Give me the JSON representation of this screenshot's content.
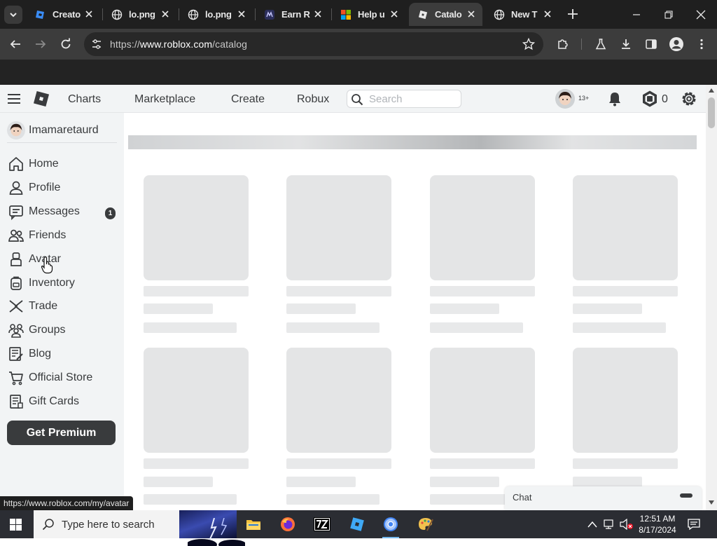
{
  "browser": {
    "tabs": [
      {
        "title": "Creato",
        "favicon": "creator-hub-icon"
      },
      {
        "title": "lo.png",
        "favicon": "globe-icon"
      },
      {
        "title": "lo.png",
        "favicon": "globe-icon"
      },
      {
        "title": "Earn R",
        "favicon": "earn-robux-icon"
      },
      {
        "title": "Help u",
        "favicon": "microsoft-icon"
      },
      {
        "title": "Catalo",
        "favicon": "roblox-icon",
        "active": true
      },
      {
        "title": "New T",
        "favicon": "globe-icon"
      }
    ],
    "url": {
      "scheme": "https://",
      "host": "www.roblox.com",
      "path": "/catalog"
    },
    "status_url": "https://www.roblox.com/my/avatar"
  },
  "roblox": {
    "nav": {
      "charts": "Charts",
      "marketplace": "Marketplace",
      "create": "Create",
      "robux": "Robux"
    },
    "search_placeholder": "Search",
    "age_label": "13+",
    "robux_balance": "0",
    "username": "Imamaretaurd",
    "sidebar": [
      {
        "label": "Home",
        "icon": "home-icon"
      },
      {
        "label": "Profile",
        "icon": "profile-icon"
      },
      {
        "label": "Messages",
        "icon": "messages-icon"
      },
      {
        "label": "Friends",
        "icon": "friends-icon"
      },
      {
        "label": "Avatar",
        "icon": "avatar-icon"
      },
      {
        "label": "Inventory",
        "icon": "inventory-icon"
      },
      {
        "label": "Trade",
        "icon": "trade-icon"
      },
      {
        "label": "Groups",
        "icon": "groups-icon"
      },
      {
        "label": "Blog",
        "icon": "blog-icon"
      },
      {
        "label": "Official Store",
        "icon": "cart-icon"
      },
      {
        "label": "Gift Cards",
        "icon": "gift-card-icon"
      }
    ],
    "messages_badge": "1",
    "premium_button": "Get Premium",
    "chat_label": "Chat"
  },
  "taskbar": {
    "search_placeholder": "Type here to search",
    "time": "12:51 AM",
    "date": "8/17/2024"
  },
  "colors": {
    "roblox_text": "#393b3d",
    "roblox_bg": "#f2f4f5",
    "skeleton": "#e4e5e6",
    "browser_dark": "#1f1f1f"
  }
}
